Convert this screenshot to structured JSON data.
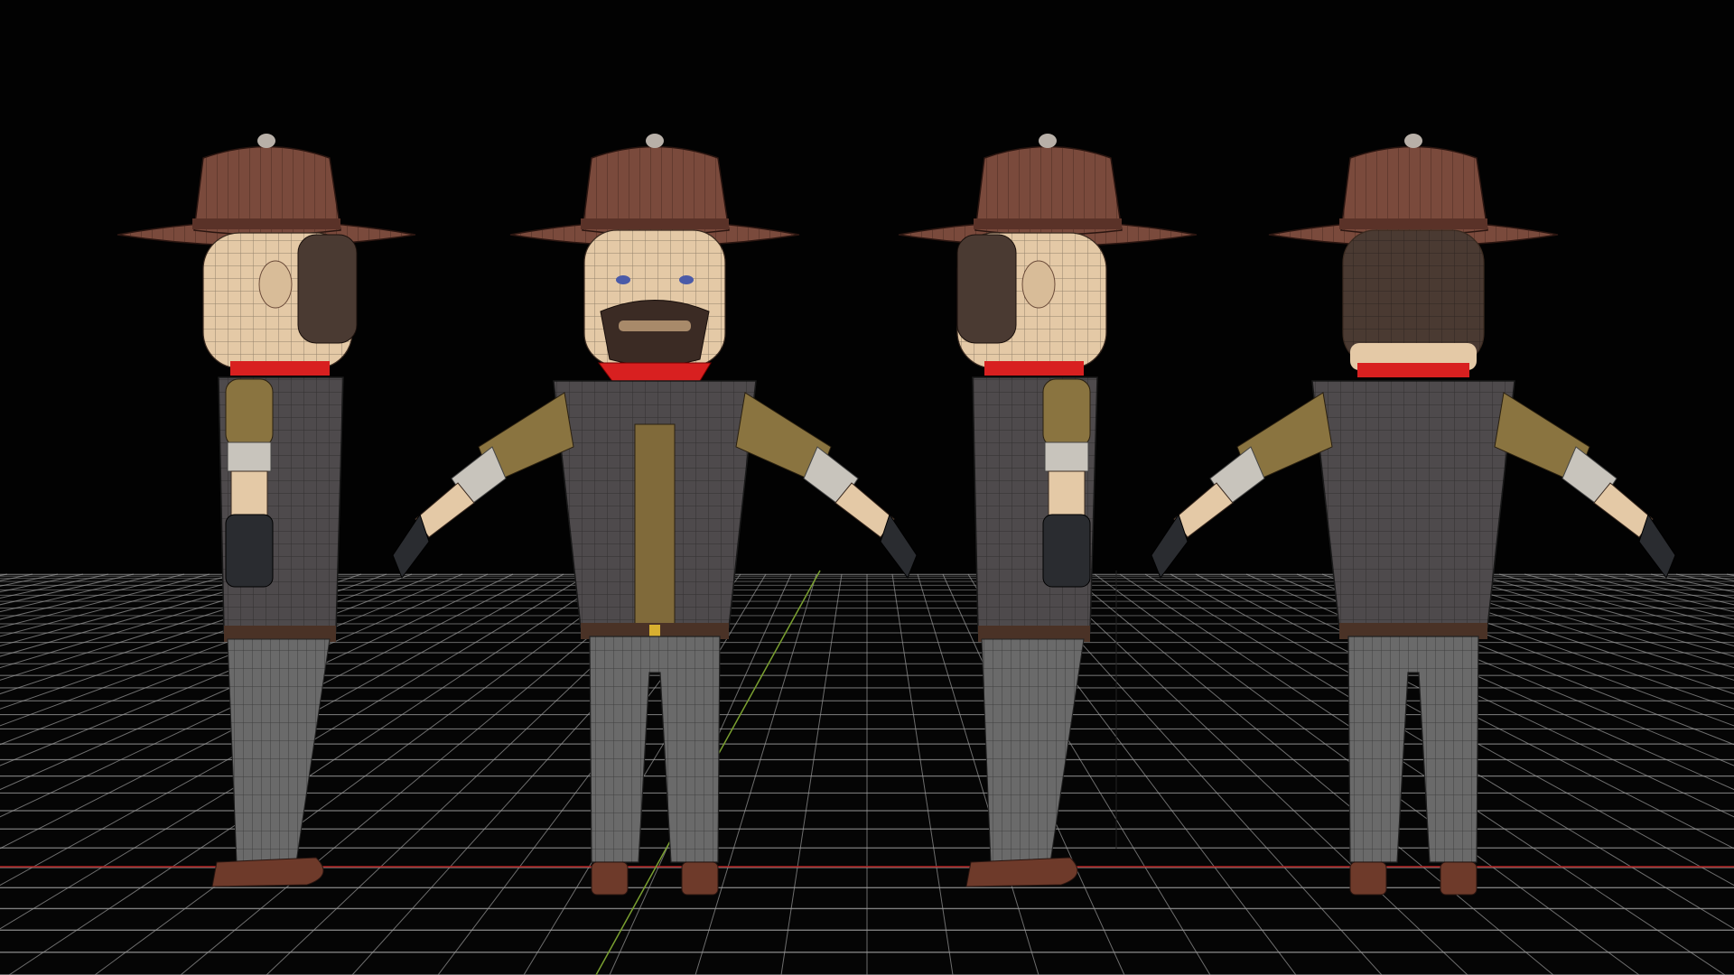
{
  "viewport": {
    "background": "#020202",
    "grid_color": "#9a9a9a",
    "x_axis_color": "#b02020",
    "y_axis_color": "#7aa030"
  },
  "model": {
    "views": [
      "side-left",
      "front",
      "side-right",
      "back"
    ],
    "colors": {
      "hat": "#7a4a3c",
      "hat_dark": "#5a3228",
      "skin": "#e4c9a6",
      "hair": "#4a3a32",
      "beard": "#3b2b24",
      "bandana": "#d82020",
      "jacket": "#4e4a4c",
      "shirt": "#806a3a",
      "sleeve_upper": "#8a7440",
      "cuff": "#c8c4bc",
      "glove": "#2a2c30",
      "belt": "#4a3226",
      "pants": "#6a6a6a",
      "boot": "#6e3a2a"
    }
  }
}
